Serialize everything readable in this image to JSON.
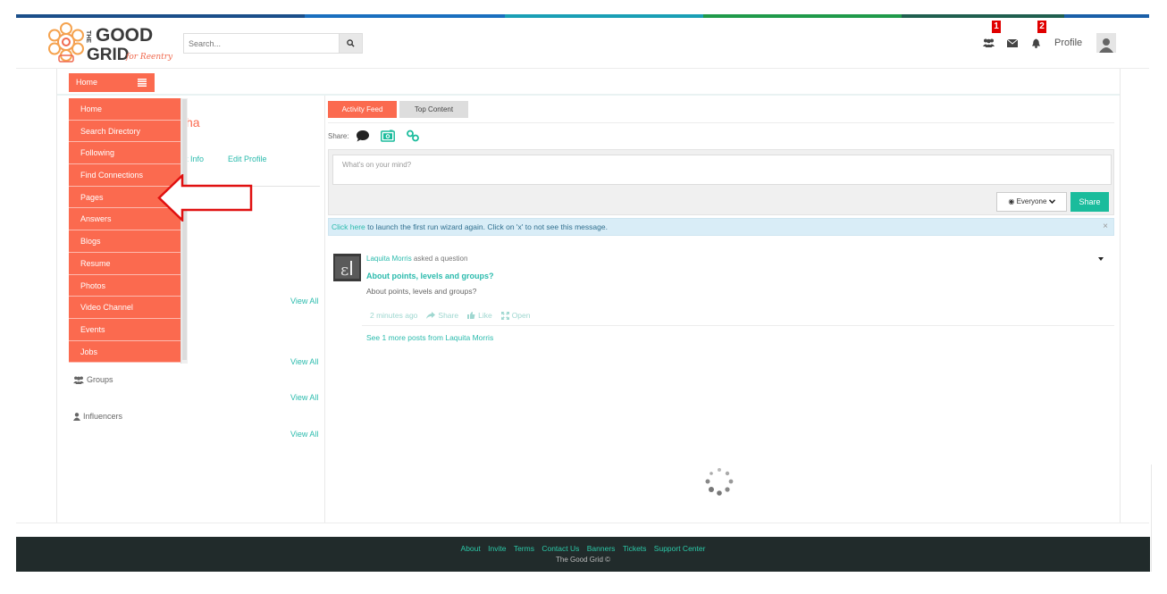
{
  "colors": {
    "accent": "#fb6a4f",
    "teal": "#2bbbad",
    "share": "#1abc9c",
    "footer_bg": "#212b2b",
    "strip": [
      "#1b4f8a",
      "#1a6fbf",
      "#1a9fb5",
      "#1f9a4a",
      "#1f5f4f",
      "#1a5fa8"
    ]
  },
  "header": {
    "logo_alt": "THE GOOD GRID for Reentry",
    "logo_line1": "THE",
    "logo_good": "GOOD",
    "logo_grid": "GRID",
    "logo_script": "for Reentry",
    "search_placeholder": "Search...",
    "friends_badge": "1",
    "notifications_badge": "2",
    "profile_label": "Profile"
  },
  "nav": {
    "home_label": "Home",
    "menu_items": [
      "Home",
      "Search Directory",
      "Following",
      "Find Connections",
      "Pages",
      "Answers",
      "Blogs",
      "Resume",
      "Photos",
      "Video Channel",
      "Events",
      "Jobs"
    ]
  },
  "sidebar": {
    "name_partial": "ha",
    "contact_partial": "t Info",
    "edit_profile": "Edit Profile",
    "view_all": "View All",
    "groups_label": "Groups",
    "influencers_label": "Influencers"
  },
  "feed": {
    "tabs": [
      "Activity Feed",
      "Top Content"
    ],
    "share_label": "Share:",
    "compose_placeholder": "What's on your mind?",
    "audience_label": "Everyone",
    "share_button": "Share",
    "notice_link": "Click here",
    "notice_text": " to launch the first run wizard again. Click on 'x' to not see this message.",
    "notice_close": "×",
    "post": {
      "author": "Laquita Morris",
      "action": " asked a question",
      "title": "About points, levels and groups?",
      "body": "About points, levels and groups?",
      "time": "2 minutes ago",
      "share": "Share",
      "like": "Like",
      "open": "Open",
      "see_more": "See 1 more posts from Laquita Morris"
    }
  },
  "footer": {
    "links": [
      "About",
      "Invite",
      "Terms",
      "Contact Us",
      "Banners",
      "Tickets",
      "Support Center"
    ],
    "copyright": "The Good Grid ©"
  }
}
